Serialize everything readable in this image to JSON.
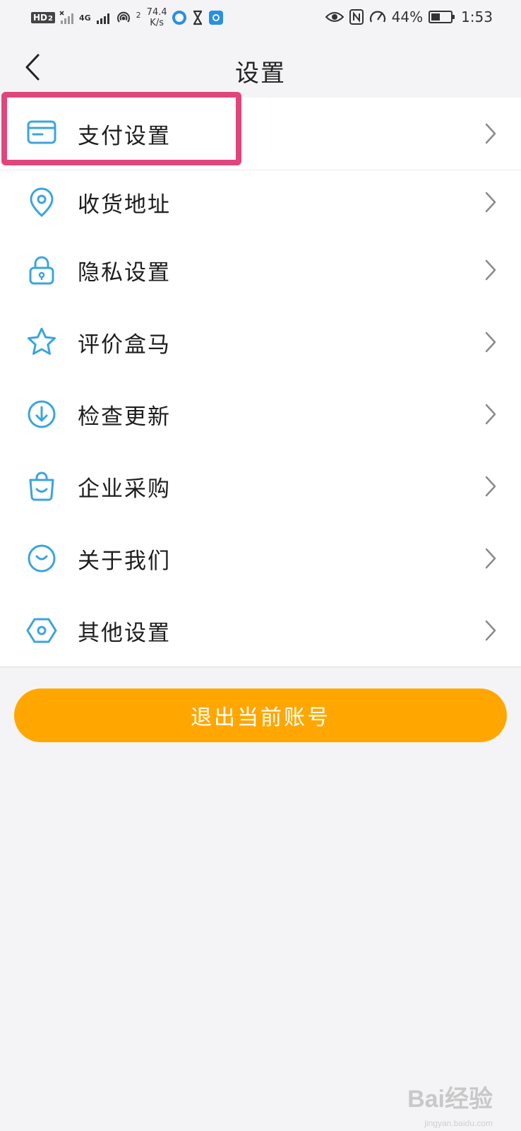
{
  "status_bar": {
    "hd": "HD",
    "hd_sub": "2",
    "network": "4G",
    "hotspot_sup": "2",
    "speed_value": "74.4",
    "speed_unit": "K/s",
    "battery_text": "44%",
    "battery_level": 0.44,
    "time": "1:53"
  },
  "nav": {
    "title": "设置"
  },
  "menu": {
    "items": [
      {
        "label": "支付设置",
        "icon": "payment-card-icon"
      },
      {
        "label": "收货地址",
        "icon": "location-pin-icon"
      },
      {
        "label": "隐私设置",
        "icon": "lock-icon"
      },
      {
        "label": "评价盒马",
        "icon": "star-icon"
      },
      {
        "label": "检查更新",
        "icon": "download-icon"
      },
      {
        "label": "企业采购",
        "icon": "shopping-bag-icon"
      },
      {
        "label": "关于我们",
        "icon": "smile-icon"
      },
      {
        "label": "其他设置",
        "icon": "hexagon-settings-icon"
      }
    ]
  },
  "logout": {
    "label": "退出当前账号"
  },
  "watermark": {
    "text": "Bai经验",
    "sub": "jingyan.baidu.com"
  },
  "colors": {
    "accent": "#3ba4e0",
    "logout_button": "#ffa700",
    "highlight": "#e0457b",
    "background": "#f4f4f6"
  }
}
